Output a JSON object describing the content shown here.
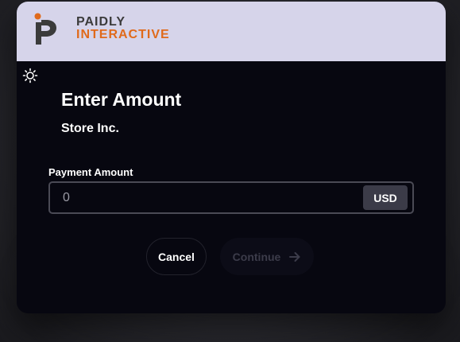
{
  "brand": {
    "line1": "PAIDLY",
    "line2": "INTERACTIVE",
    "accent_color": "#e06a1b",
    "header_color": "#d6d4ea"
  },
  "theme_toggle": {
    "icon": "sun-icon"
  },
  "page": {
    "title": "Enter Amount",
    "merchant": "Store Inc."
  },
  "amount_field": {
    "label": "Payment Amount",
    "placeholder": "0",
    "value": "",
    "currency": "USD"
  },
  "actions": {
    "cancel_label": "Cancel",
    "continue_label": "Continue",
    "continue_icon": "arrow-right-icon",
    "continue_enabled": false
  }
}
